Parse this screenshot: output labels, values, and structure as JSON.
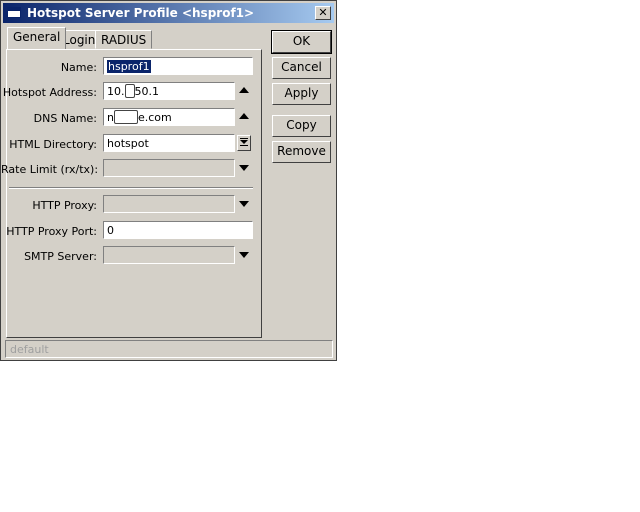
{
  "window": {
    "title": "Hotspot Server Profile <hsprof1>",
    "close_label": "✕"
  },
  "tabs": [
    {
      "label": "General",
      "active": true
    },
    {
      "label": "Login",
      "active": false
    },
    {
      "label": "RADIUS",
      "active": false
    }
  ],
  "fields": {
    "name": {
      "label": "Name:",
      "value": "hsprof1"
    },
    "hotspot_address": {
      "label": "Hotspot Address:",
      "value_prefix": "10.",
      "value_suffix": "50.1"
    },
    "dns_name": {
      "label": "DNS Name:",
      "value_prefix": "n",
      "value_suffix": "e.com"
    },
    "html_directory": {
      "label": "HTML Directory:",
      "value": "hotspot"
    },
    "rate_limit": {
      "label": "Rate Limit (rx/tx):",
      "value": ""
    },
    "http_proxy": {
      "label": "HTTP Proxy:",
      "value": ""
    },
    "http_proxy_port": {
      "label": "HTTP Proxy Port:",
      "value": "0"
    },
    "smtp_server": {
      "label": "SMTP Server:",
      "value": ""
    }
  },
  "buttons": {
    "ok": "OK",
    "cancel": "Cancel",
    "apply": "Apply",
    "copy": "Copy",
    "remove": "Remove"
  },
  "status": {
    "text": "default"
  },
  "colors": {
    "titlebar_start": "#0a246a",
    "titlebar_end": "#a6caf0",
    "face": "#d4d0c8"
  }
}
